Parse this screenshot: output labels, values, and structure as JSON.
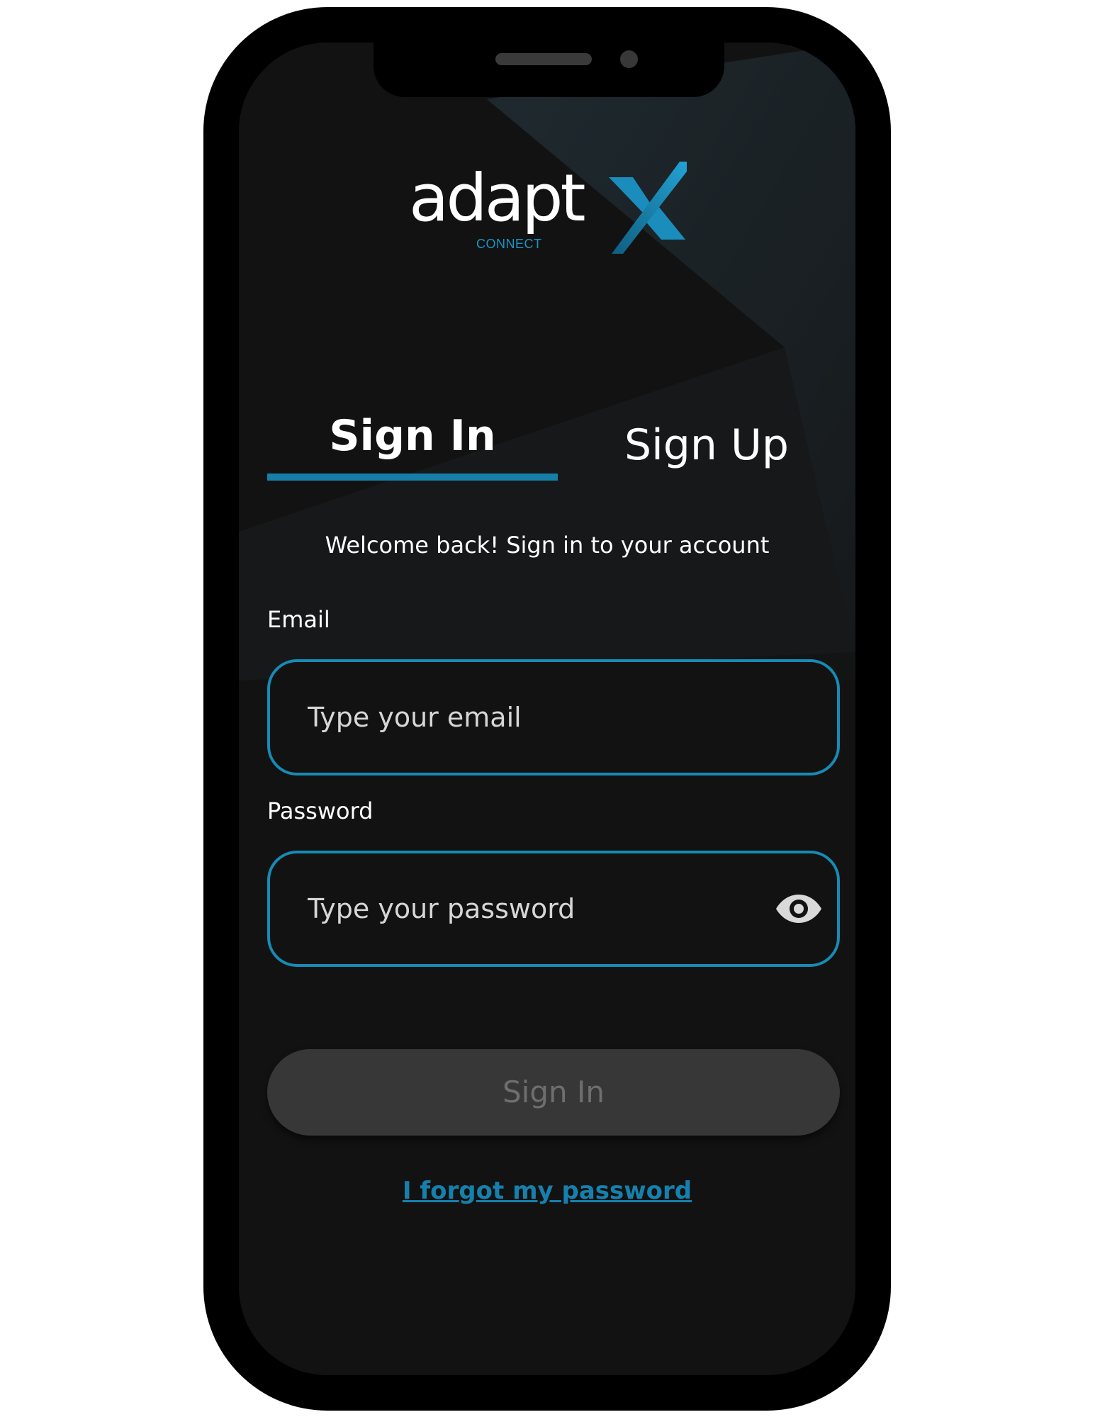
{
  "brand": {
    "name": "adapt",
    "subtitle": "CONNECT",
    "accent_color": "#1a94c6"
  },
  "tabs": [
    {
      "label": "Sign In",
      "active": true
    },
    {
      "label": "Sign Up",
      "active": false
    }
  ],
  "welcome_text": "Welcome back! Sign in to your account",
  "email": {
    "label": "Email",
    "placeholder": "Type your email",
    "value": ""
  },
  "password": {
    "label": "Password",
    "placeholder": "Type your password",
    "value": "",
    "toggle_icon": "eye-icon"
  },
  "submit": {
    "label": "Sign In",
    "enabled": false
  },
  "forgot_link": "I forgot my password",
  "colors": {
    "screen_bg": "#121212",
    "input_border": "#168bb5",
    "tab_indicator": "#157fa8",
    "button_bg": "#373737",
    "button_text": "#6e6e6e",
    "link": "#1680ad"
  }
}
